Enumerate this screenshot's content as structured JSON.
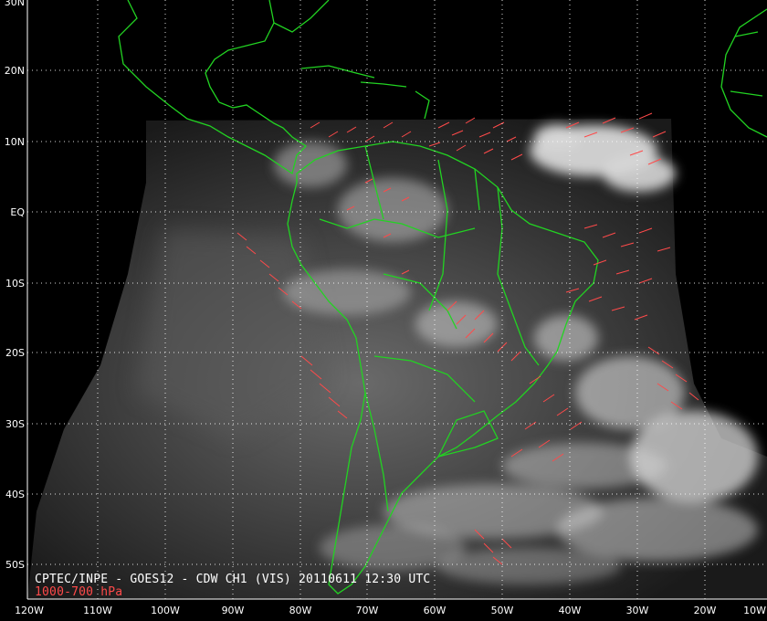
{
  "map": {
    "lat_labels": [
      "30N",
      "20N",
      "10N",
      "EQ",
      "10S",
      "20S",
      "30S",
      "40S",
      "50S"
    ],
    "lon_labels": [
      "120W",
      "110W",
      "100W",
      "90W",
      "80W",
      "70W",
      "60W",
      "50W",
      "40W",
      "30W",
      "20W",
      "10W"
    ],
    "colors": {
      "background": "#000000",
      "coastline": "#22d322",
      "wind_vectors": "#ff4a4a",
      "grid": "#ffffff",
      "clouds": "#d8d8d8"
    }
  },
  "caption": {
    "line1": "CPTEC/INPE - GOES12 - CDW CH1 (VIS) 20110611 12:30 UTC",
    "line2": "1000-700 hPa"
  }
}
